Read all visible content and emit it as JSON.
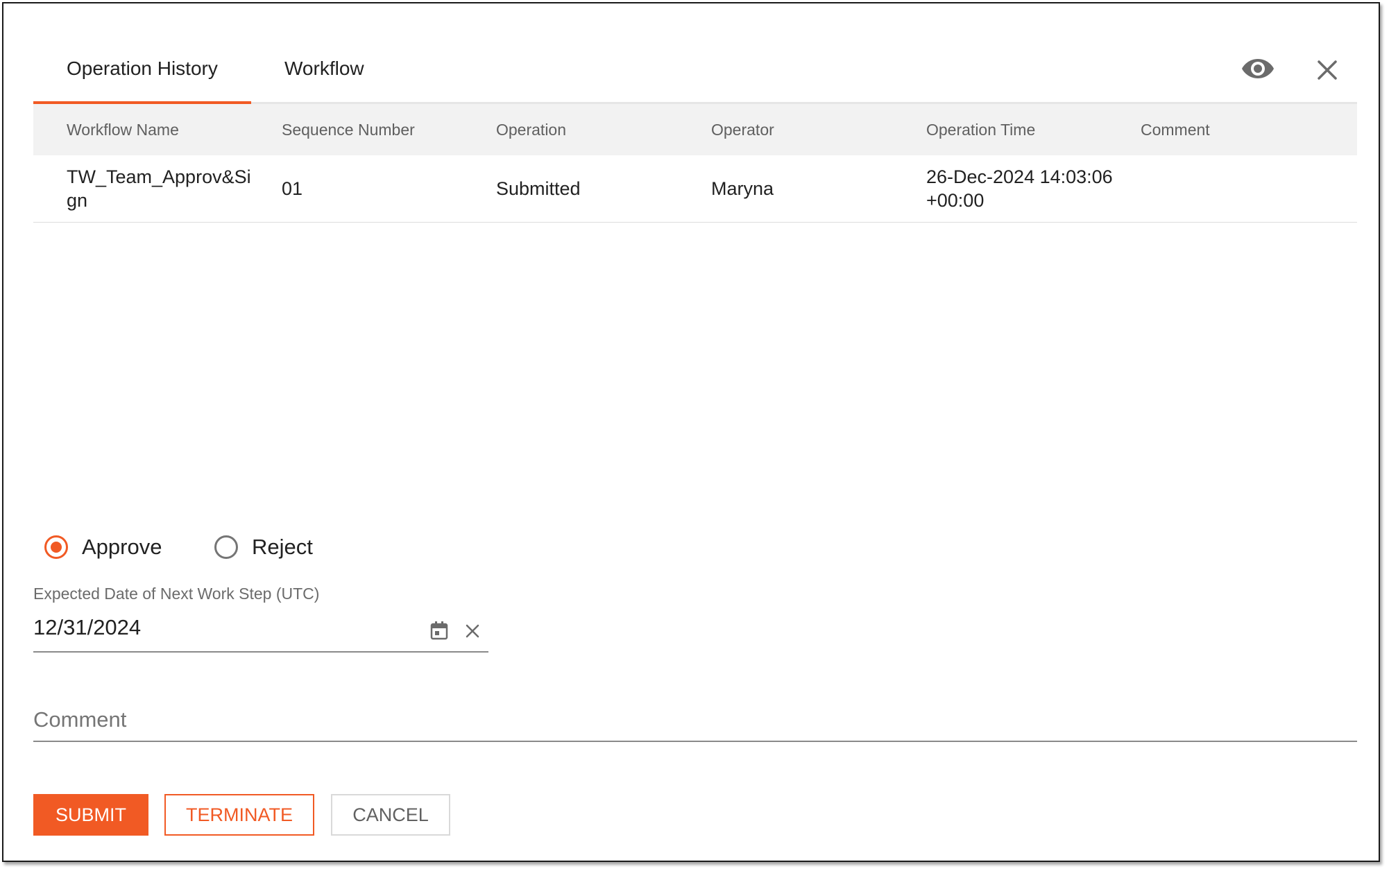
{
  "tabs": [
    {
      "label": "Operation History",
      "active": true
    },
    {
      "label": "Workflow",
      "active": false
    }
  ],
  "header_icons": {
    "preview": "eye-icon",
    "close": "close-icon"
  },
  "table": {
    "headers": [
      "Workflow Name",
      "Sequence Number",
      "Operation",
      "Operator",
      "Operation Time",
      "Comment"
    ],
    "rows": [
      {
        "workflow_name": "TW_Team_Approv&Sign",
        "sequence_number": "01",
        "operation": "Submitted",
        "operator": "Maryna",
        "operation_time": "26-Dec-2024 14:03:06 +00:00",
        "comment": ""
      }
    ]
  },
  "decision": {
    "options": [
      {
        "label": "Approve",
        "selected": true
      },
      {
        "label": "Reject",
        "selected": false
      }
    ]
  },
  "date_field": {
    "label": "Expected Date of Next Work Step (UTC)",
    "value": "12/31/2024",
    "calendar_icon": "calendar-icon",
    "clear_icon": "close-icon"
  },
  "comment_field": {
    "placeholder": "Comment",
    "value": ""
  },
  "actions": {
    "submit": "SUBMIT",
    "terminate": "TERMINATE",
    "cancel": "CANCEL"
  },
  "colors": {
    "accent": "#f15a24",
    "header_bg": "#f2f2f2",
    "text": "#212121",
    "muted_text": "#5f5f5f"
  }
}
